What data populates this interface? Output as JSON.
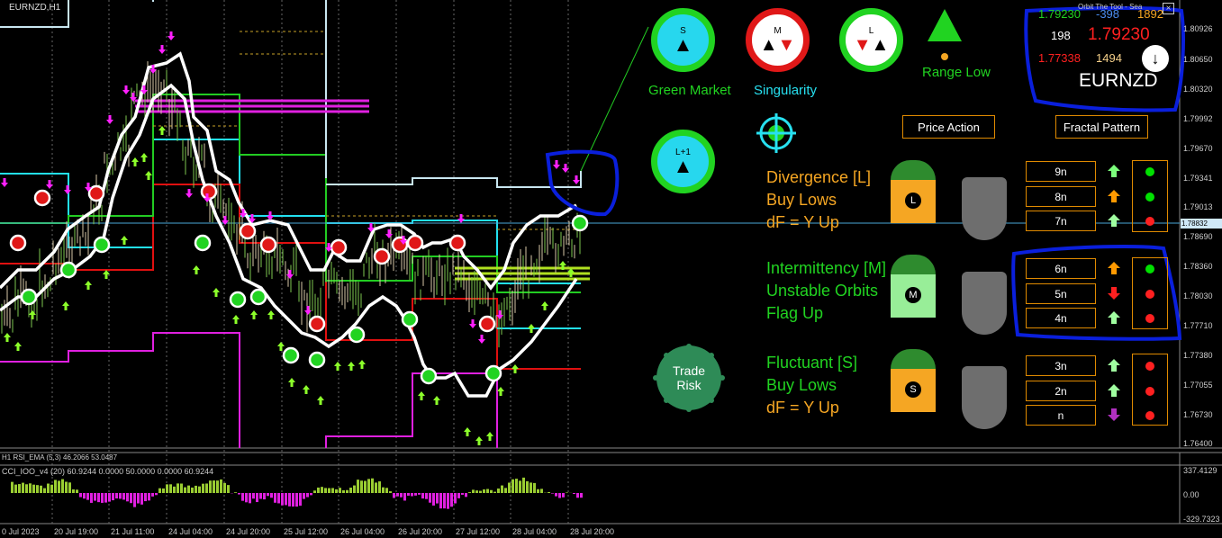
{
  "chart": {
    "symbol_label": "EURNZD,H1",
    "price_current": "1.78832",
    "y_ticks": [
      "1.80926",
      "1.80650",
      "1.80320",
      "1.79992",
      "1.79670",
      "1.79341",
      "1.79013",
      "1.78690",
      "1.78360",
      "1.78030",
      "1.77710",
      "1.77380",
      "1.77055",
      "1.76730",
      "1.76400"
    ],
    "x_ticks": [
      "0 Jul 2023",
      "20 Jul 19:00",
      "21 Jul 11:00",
      "24 Jul 04:00",
      "24 Jul 20:00",
      "25 Jul 12:00",
      "26 Jul 04:00",
      "26 Jul 20:00",
      "27 Jul 12:00",
      "28 Jul 04:00",
      "28 Jul 20:00"
    ],
    "rsi_label": "H1 RSI_EMA (5,3) 46.2066 53.0487",
    "cci_label": "CCI_IOO_v4 (20) 60.9244 0.0000 50.0000 0.0000 60.9244",
    "cci_ticks": [
      "337.4129",
      "0.00",
      "-329.7323"
    ]
  },
  "info_box": {
    "title": "Orbit The Tool - Sea",
    "price_top_left": "1.79230",
    "value_top_mid": "-398",
    "value_top_right": "1892",
    "value_mid_left": "198",
    "price_big": "1.79230",
    "price_low": "1.77338",
    "value_low_right": "1494",
    "symbol": "EURNZD",
    "close_icon": "close-icon"
  },
  "markets": {
    "circle_s": "S",
    "circle_m": "M",
    "circle_l": "L",
    "circle_l1": "L+1",
    "range_low_label": "Range Low",
    "green_market_label": "Green Market",
    "singularity_label": "Singularity",
    "trade_risk_label_1": "Trade",
    "trade_risk_label_2": "Risk"
  },
  "buttons": {
    "price_action": "Price Action",
    "fractal_pattern": "Fractal Pattern"
  },
  "sections": {
    "divergence": {
      "title": "Divergence [L]",
      "line2": "Buy Lows",
      "line3": "dF = Y Up",
      "badge": "L"
    },
    "intermittency": {
      "title": "Intermittency [M]",
      "line2": "Unstable Orbits",
      "line3": "Flag Up",
      "badge": "M"
    },
    "fluctuant": {
      "title": "Fluctuant [S]",
      "line2": "Buy Lows",
      "line3": "dF = Y Up",
      "badge": "S"
    }
  },
  "fractals": {
    "rows": [
      {
        "label": "9n",
        "arrow": "up",
        "arrow_color": "#7cff7c",
        "dot": "#00e000"
      },
      {
        "label": "8n",
        "arrow": "up",
        "arrow_color": "#ff9900",
        "dot": "#00e000"
      },
      {
        "label": "7n",
        "arrow": "up",
        "arrow_color": "#a0ffa0",
        "dot": "#ff2020"
      },
      {
        "label": "6n",
        "arrow": "up",
        "arrow_color": "#ff9900",
        "dot": "#00e000"
      },
      {
        "label": "5n",
        "arrow": "down",
        "arrow_color": "#ff2020",
        "dot": "#ff2020"
      },
      {
        "label": "4n",
        "arrow": "up",
        "arrow_color": "#a0ffa0",
        "dot": "#ff2020"
      },
      {
        "label": "3n",
        "arrow": "up",
        "arrow_color": "#a0ffa0",
        "dot": "#ff2020"
      },
      {
        "label": "2n",
        "arrow": "up",
        "arrow_color": "#a0ffa0",
        "dot": "#ff2020"
      },
      {
        "label": "n",
        "arrow": "down",
        "arrow_color": "#b030c0",
        "dot": "#ff2020"
      }
    ]
  },
  "colors": {
    "orange": "#f5a623",
    "green": "#21d321",
    "cyan": "#27e0f0",
    "blue_annotation": "#0a1fdc"
  }
}
